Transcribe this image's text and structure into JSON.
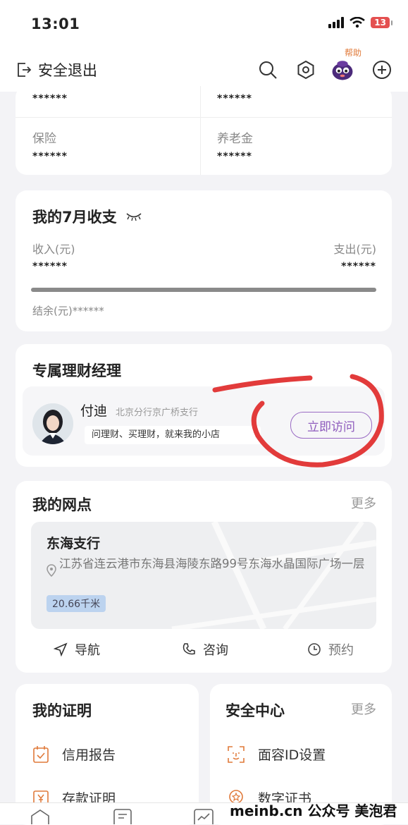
{
  "status": {
    "time": "13:01",
    "battery": "13"
  },
  "topbar": {
    "logout_label": "安全退出",
    "help_label": "帮助"
  },
  "assets": {
    "row0": {
      "left_value": "******",
      "right_value": "******"
    },
    "row1": {
      "left_label": "保险",
      "left_value": "******",
      "right_label": "养老金",
      "right_value": "******"
    }
  },
  "monthly": {
    "title": "我的7月收支",
    "income_label": "收入(元)",
    "income_value": "******",
    "expense_label": "支出(元)",
    "expense_value": "******",
    "balance": "结余(元)******"
  },
  "manager": {
    "section_title": "专属理财经理",
    "name": "付迪",
    "branch": "北京分行京广桥支行",
    "tagline": "问理财、买理财，就来我的小店",
    "visit_label": "立即访问"
  },
  "branches": {
    "section_title": "我的网点",
    "more_label": "更多",
    "branch_name": "东海支行",
    "address": "江苏省连云港市东海县海陵东路99号东海水晶国际广场一层",
    "distance": "20.66千米",
    "actions": {
      "navigate": "导航",
      "consult": "咨询",
      "reserve": "预约"
    }
  },
  "certificates": {
    "section_title": "我的证明",
    "items": [
      "信用报告",
      "存款证明"
    ]
  },
  "security": {
    "section_title": "安全中心",
    "more_label": "更多",
    "items": [
      "面容ID设置",
      "数字证书"
    ]
  },
  "watermark": "meinb.cn 公众号 美泡君",
  "colors": {
    "accent_purple": "#8e5bbd",
    "annotation_red": "#e23b3b",
    "distance_badge": "#bcd3ef"
  }
}
